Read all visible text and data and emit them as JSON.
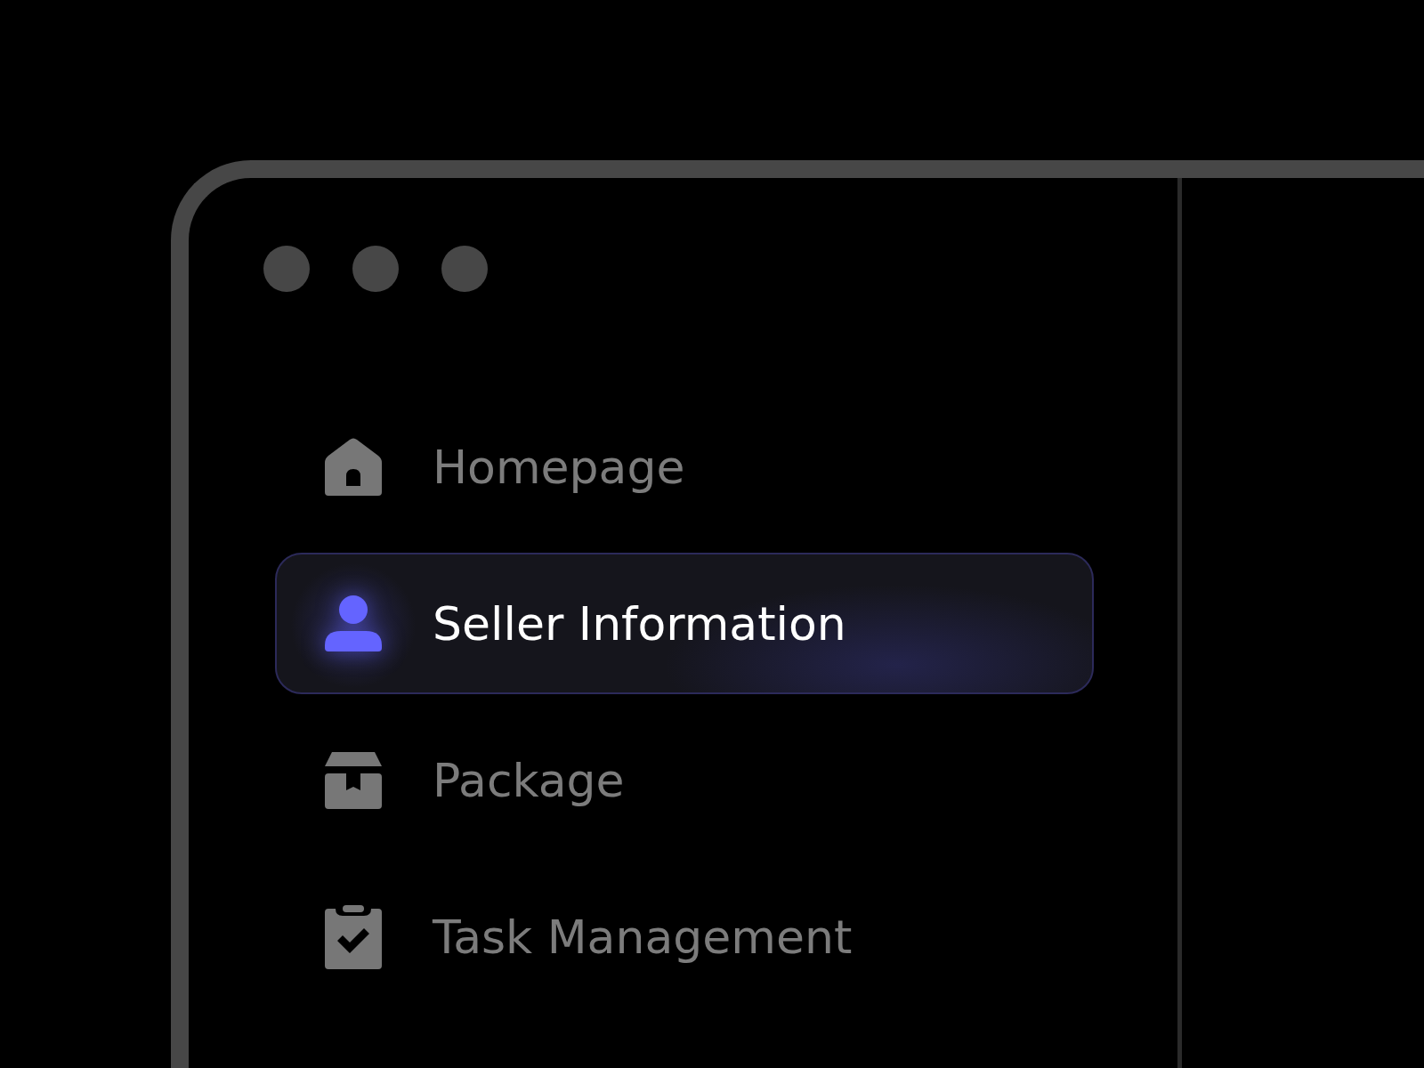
{
  "sidebar": {
    "items": [
      {
        "label": "Homepage",
        "selected": false
      },
      {
        "label": "Seller Information",
        "selected": true
      },
      {
        "label": "Package",
        "selected": false
      },
      {
        "label": "Task Management",
        "selected": false
      }
    ]
  }
}
